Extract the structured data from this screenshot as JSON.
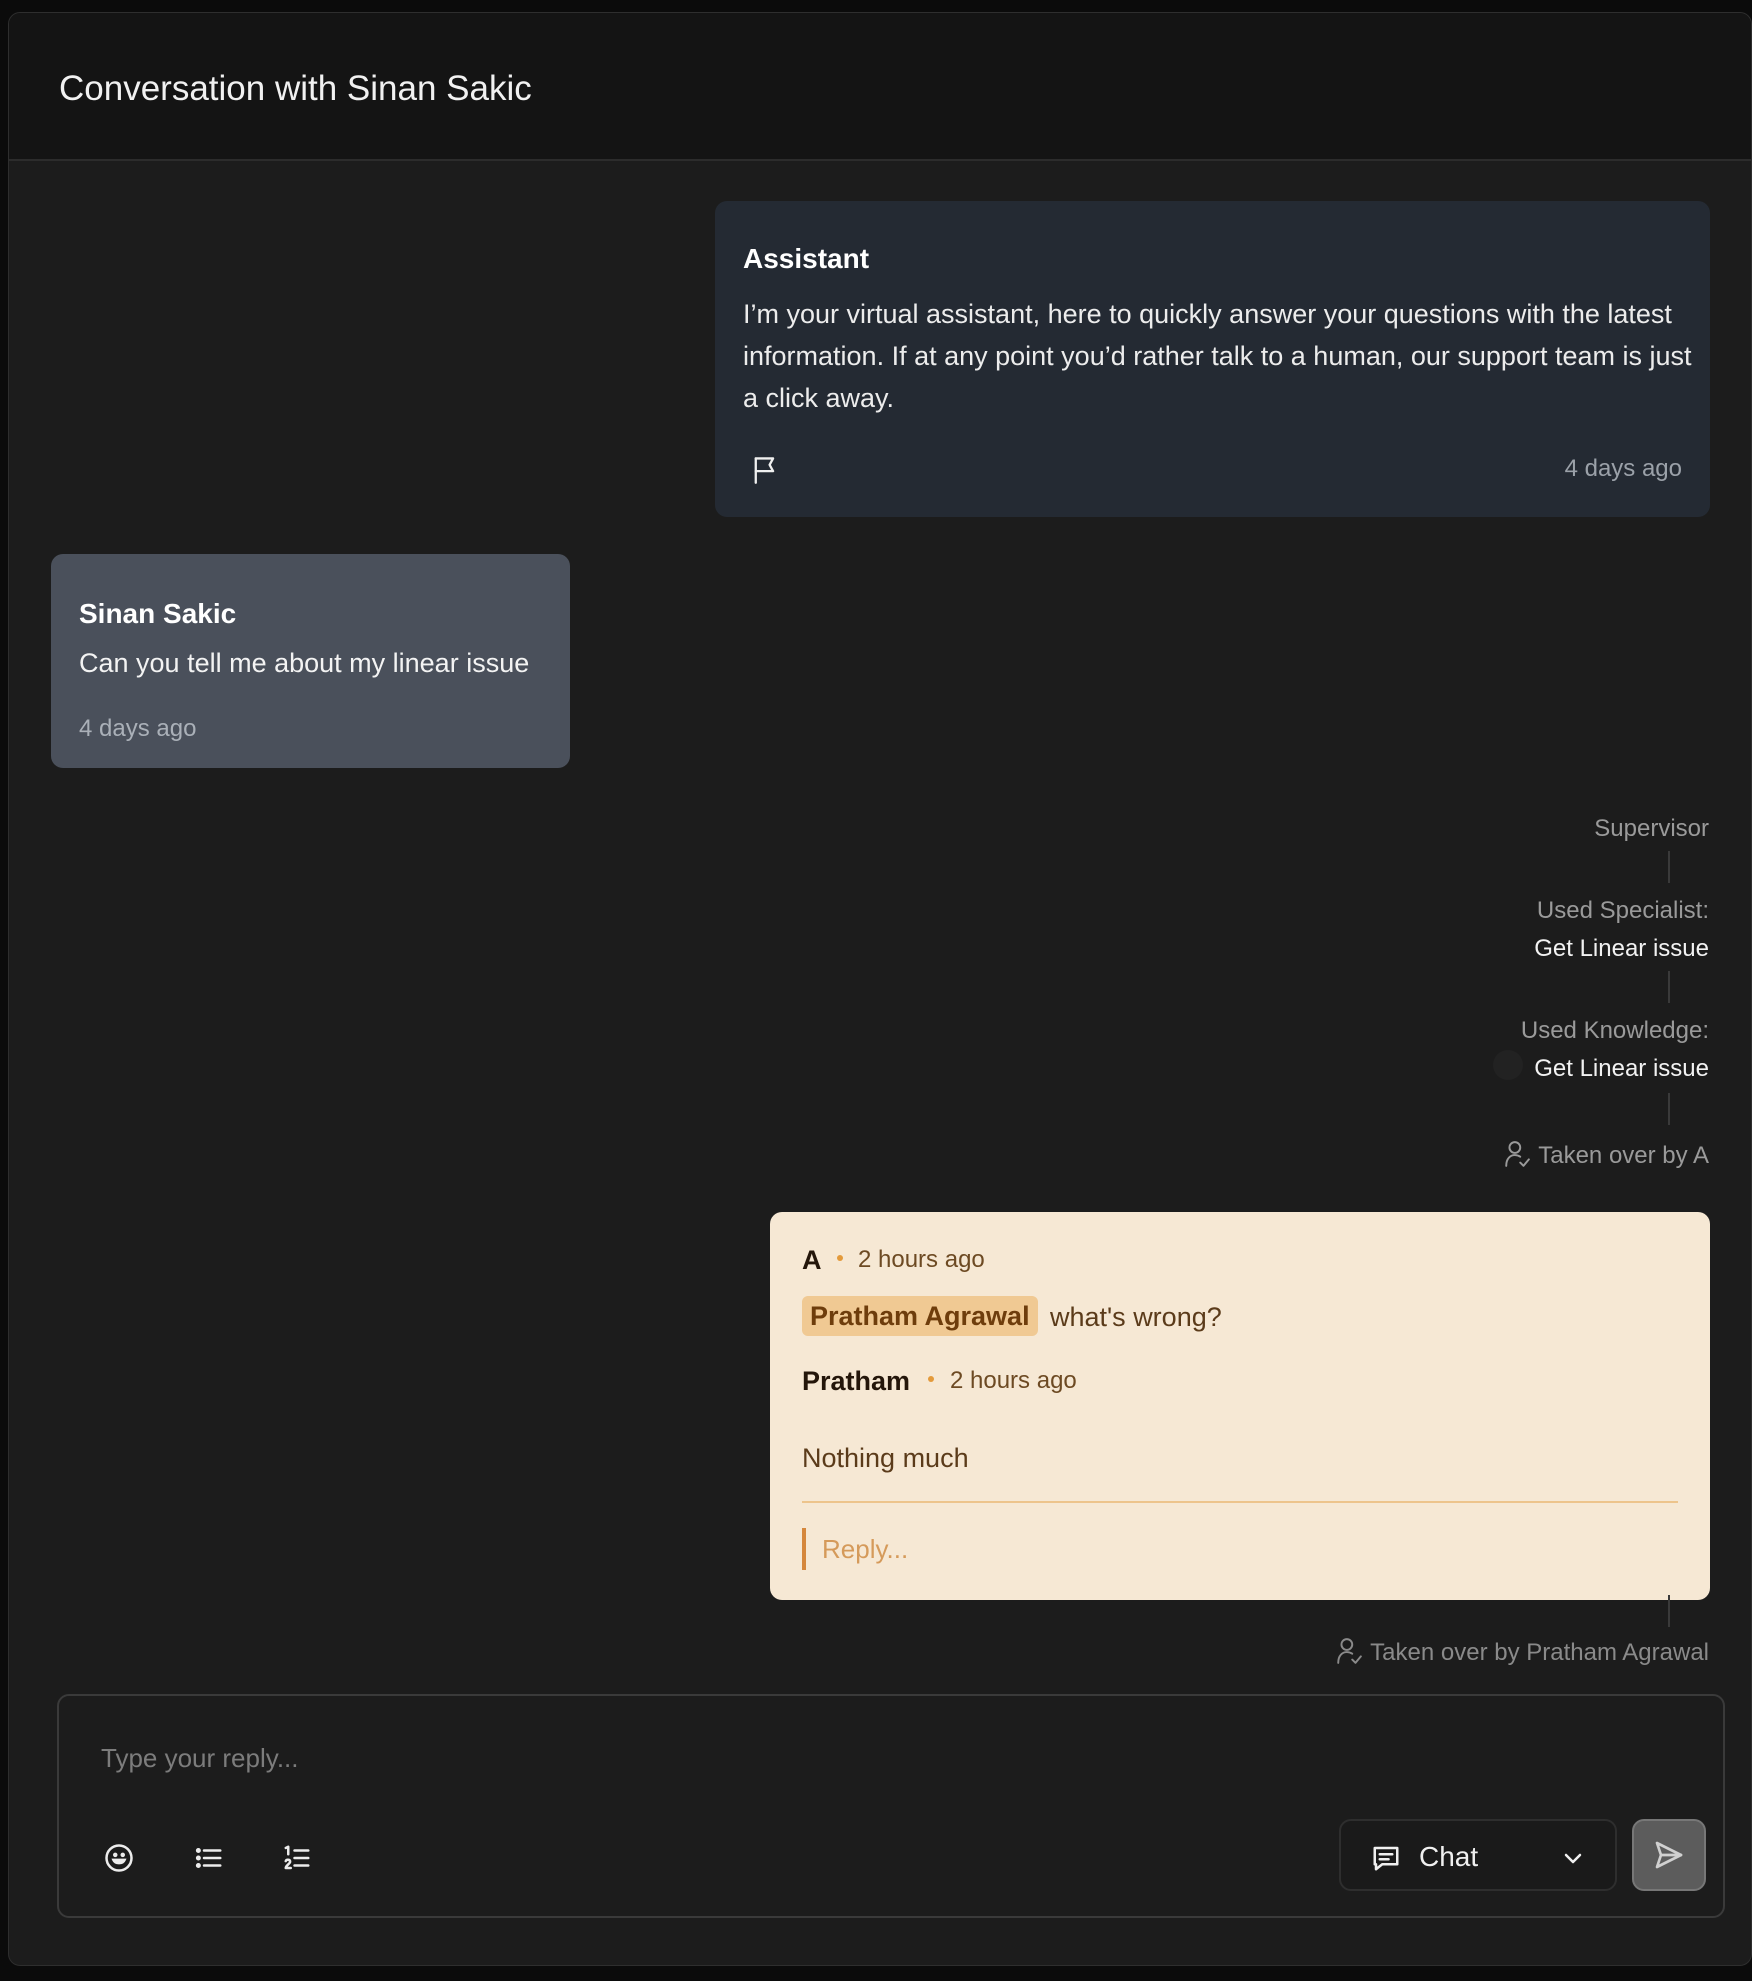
{
  "header": {
    "title": "Conversation with Sinan Sakic"
  },
  "assistant_message": {
    "author": "Assistant",
    "text": "I’m your virtual assistant, here to quickly answer your questions with the latest information. If at any point you’d rather talk to a human, our support team is just a click away.",
    "time": "4 days ago",
    "icon": "flag-icon"
  },
  "user_message": {
    "author": "Sinan Sakic",
    "text": "Can you tell me about my linear issue",
    "time": "4 days ago"
  },
  "timeline": {
    "supervisor": "Supervisor",
    "specialist_label": "Used Specialist:",
    "specialist_value": "Get Linear issue",
    "knowledge_label": "Used Knowledge:",
    "knowledge_value": "Get Linear issue",
    "taken_over_a": "Taken over by A",
    "taken_over_pratham": "Taken over by Pratham Agrawal"
  },
  "thread": {
    "first": {
      "author": "A",
      "time": "2 hours ago",
      "mention": "Pratham Agrawal",
      "text": "what's wrong?"
    },
    "second": {
      "author": "Pratham",
      "time": "2 hours ago",
      "text": "Nothing much"
    },
    "reply_placeholder": "Reply..."
  },
  "composer": {
    "placeholder": "Type your reply...",
    "mode": "Chat",
    "tools": [
      "emoji-icon",
      "bullet-list-icon",
      "numbered-list-icon"
    ],
    "send_icon": "send-icon"
  },
  "colors": {
    "background": "#1c1c1c",
    "assistant_bubble": "#242a33",
    "user_bubble": "#4a505b",
    "thread_bg": "#f6e8d4",
    "mention_bg": "#f0c993",
    "accent_orange": "#e39a3b"
  }
}
